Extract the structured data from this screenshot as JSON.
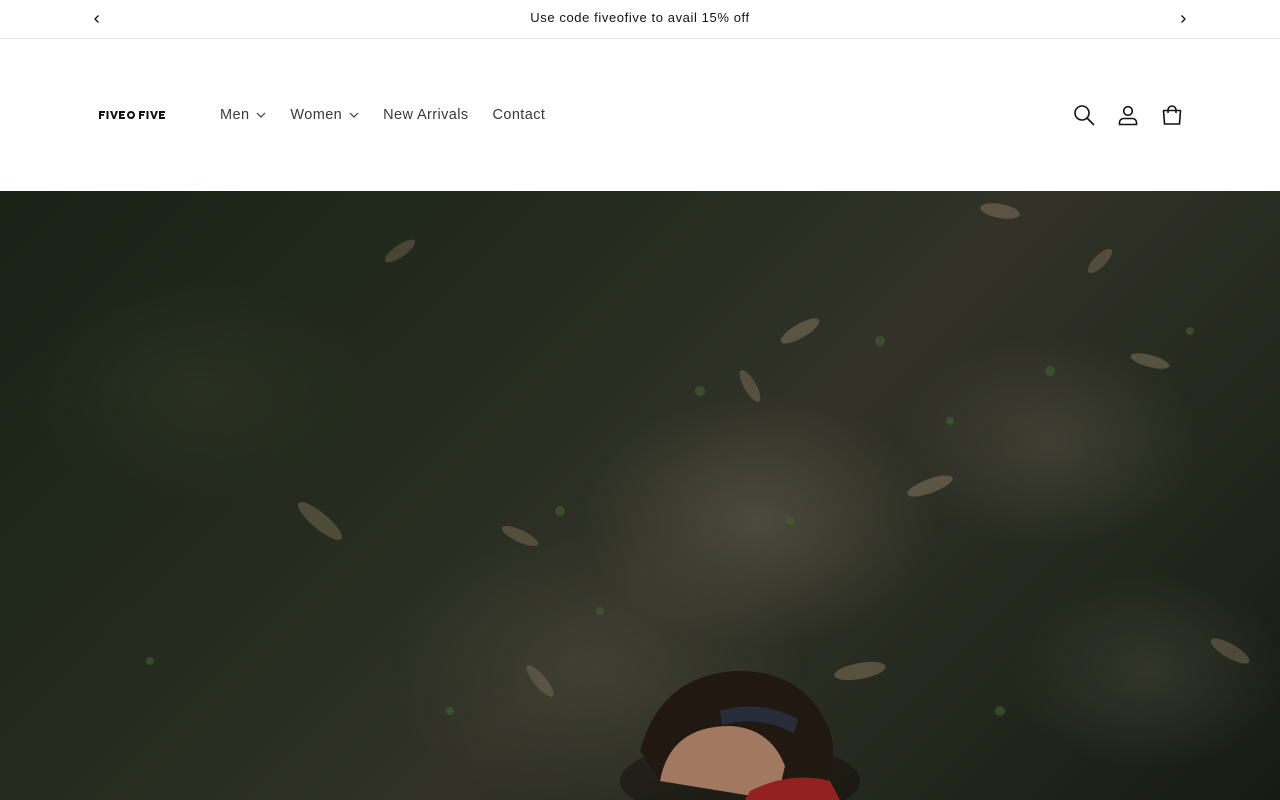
{
  "announcement": {
    "message": "Use code fiveofive to avail 15% off"
  },
  "header": {
    "logo_text": "FIVEOFIVE",
    "nav": [
      {
        "label": "Men",
        "has_dropdown": true
      },
      {
        "label": "Women",
        "has_dropdown": true
      },
      {
        "label": "New Arrivals",
        "has_dropdown": false
      },
      {
        "label": "Contact",
        "has_dropdown": false
      }
    ],
    "icons": [
      "search-icon",
      "account-icon",
      "cart-icon"
    ]
  },
  "hero": {
    "image": "person-lying-on-grass-with-leaves"
  },
  "colors": {
    "text": "#121212",
    "nav_text": "#3a3a3a",
    "border": "#e6e6e6",
    "hero_dark_green": "#2e3626",
    "jacket_red": "#b5292a"
  }
}
